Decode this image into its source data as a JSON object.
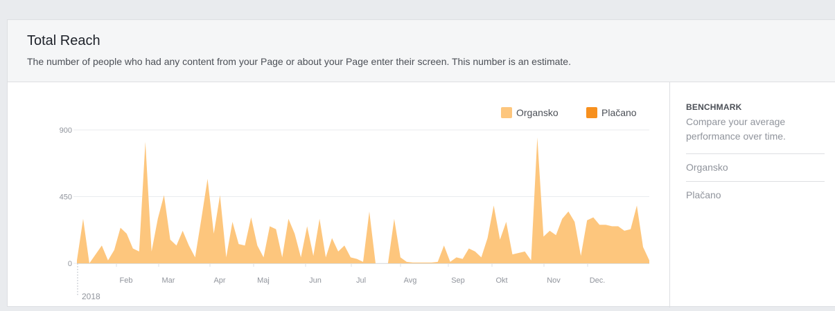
{
  "header": {
    "title": "Total Reach",
    "subtitle": "The number of people who had any content from your Page or about your Page enter their screen. This number is an estimate."
  },
  "benchmark": {
    "title": "BENCHMARK",
    "description": "Compare your average performance over time.",
    "items": [
      {
        "label": "Organsko"
      },
      {
        "label": "Plačano"
      }
    ]
  },
  "colors": {
    "organic": "#fdc67d",
    "paid": "#f7901e",
    "grid": "#e9ebee",
    "axis_text": "#90949c"
  },
  "chart_data": {
    "type": "area",
    "legend": [
      {
        "name": "Organsko",
        "color": "#fdc67d"
      },
      {
        "name": "Plačano",
        "color": "#f7901e"
      }
    ],
    "legend_position": "top-right",
    "y_ticks": [
      "900",
      "450",
      "0"
    ],
    "ylim": [
      0,
      900
    ],
    "x_months": [
      "Feb",
      "Mar",
      "Apr",
      "Maj",
      "Jun",
      "Jul",
      "Avg",
      "Sep",
      "Okt",
      "Nov",
      "Dec."
    ],
    "x_year": "2018",
    "series": [
      {
        "name": "Organsko",
        "values": [
          20,
          300,
          0,
          60,
          120,
          20,
          90,
          240,
          200,
          100,
          80,
          820,
          80,
          300,
          460,
          160,
          120,
          220,
          120,
          40,
          300,
          570,
          200,
          460,
          40,
          280,
          130,
          120,
          310,
          120,
          40,
          250,
          230,
          40,
          300,
          200,
          40,
          250,
          50,
          300,
          40,
          170,
          80,
          120,
          40,
          30,
          10,
          350,
          0,
          0,
          0,
          300,
          40,
          10,
          5,
          5,
          5,
          5,
          10,
          120,
          10,
          40,
          30,
          100,
          80,
          40,
          170,
          390,
          160,
          280,
          60,
          70,
          80,
          20,
          850,
          180,
          220,
          190,
          300,
          350,
          280,
          50,
          290,
          310,
          260,
          260,
          250,
          250,
          220,
          230,
          390,
          110,
          20
        ]
      },
      {
        "name": "Plačano",
        "values": [
          0,
          0,
          0,
          0,
          0,
          0,
          0,
          0,
          0,
          0,
          0,
          0,
          0,
          0,
          0,
          0,
          0,
          0,
          0,
          0,
          0,
          0,
          0,
          0,
          0,
          0,
          0,
          0,
          0,
          0,
          0,
          0,
          0,
          0,
          0,
          0,
          0,
          0,
          0,
          0,
          0,
          0,
          0,
          0,
          0,
          0,
          0,
          0,
          0,
          0,
          0,
          0,
          0,
          0,
          0,
          0,
          0,
          0,
          0,
          0,
          0,
          0,
          0,
          0,
          0,
          0,
          0,
          0,
          0,
          0,
          0,
          0,
          0,
          0,
          0,
          0,
          0,
          0,
          0,
          0,
          0,
          0,
          0,
          0,
          0,
          0,
          0,
          0,
          0,
          0,
          0,
          0,
          0
        ]
      }
    ]
  }
}
